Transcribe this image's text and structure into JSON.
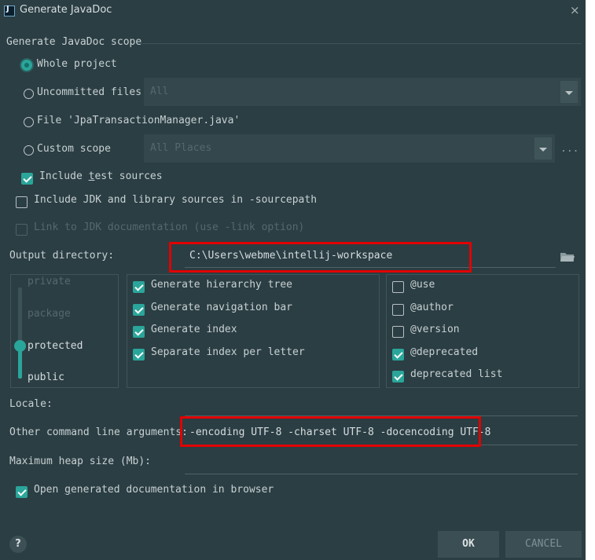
{
  "window": {
    "title": "Generate JavaDoc",
    "close_glyph": "×"
  },
  "scope": {
    "heading": "Generate JavaDoc scope",
    "options": [
      {
        "label": "Whole project",
        "selected": true
      },
      {
        "label": "Uncommitted files",
        "selected": false
      },
      {
        "label": "File 'JpaTransactionManager.java'",
        "selected": false
      },
      {
        "label": "Custom scope",
        "selected": false
      }
    ],
    "uncommitted_combo_value": "All",
    "custom_scope_combo_value": "All Places",
    "ellipsis": "..."
  },
  "options": {
    "include_test_pre": "Include ",
    "include_test_mnemonic": "t",
    "include_test_post": "est sources",
    "include_test_checked": true,
    "include_jdk": "Include JDK and library sources in -sourcepath",
    "include_jdk_checked": false,
    "link_jdk": "Link to JDK documentation (use -link option)",
    "link_jdk_checked": false
  },
  "output": {
    "label": "Output directory:",
    "value": "C:\\Users\\webme\\intellij-workspace"
  },
  "visibility": {
    "levels": [
      "private",
      "package",
      "protected",
      "public"
    ],
    "selected": "protected"
  },
  "generate": [
    {
      "label": "Generate hierarchy tree",
      "checked": true
    },
    {
      "label": "Generate navigation bar",
      "checked": true
    },
    {
      "label": "Generate index",
      "checked": true
    },
    {
      "label": "Separate index per letter",
      "checked": true
    }
  ],
  "tags": [
    {
      "label": "@use",
      "checked": false
    },
    {
      "label": "@author",
      "checked": false
    },
    {
      "label": "@version",
      "checked": false
    },
    {
      "label": "@deprecated",
      "checked": true
    },
    {
      "label": "deprecated list",
      "checked": true
    }
  ],
  "locale": {
    "label": "Locale:",
    "value": ""
  },
  "args": {
    "label": "Other command line arguments:",
    "value": "-encoding UTF-8 -charset UTF-8 -docencoding UTF-8"
  },
  "heap": {
    "label": "Maximum heap size (Mb):",
    "value": ""
  },
  "open_browser": {
    "pre": "Open ",
    "mnemonic": "g",
    "post": "enerated documentation in browser",
    "checked": true
  },
  "footer": {
    "help": "?",
    "ok": "OK",
    "cancel": "CANCEL"
  },
  "colors": {
    "background": "#2b3e43",
    "accent": "#2aa59a",
    "highlight_box": "#e10000"
  }
}
